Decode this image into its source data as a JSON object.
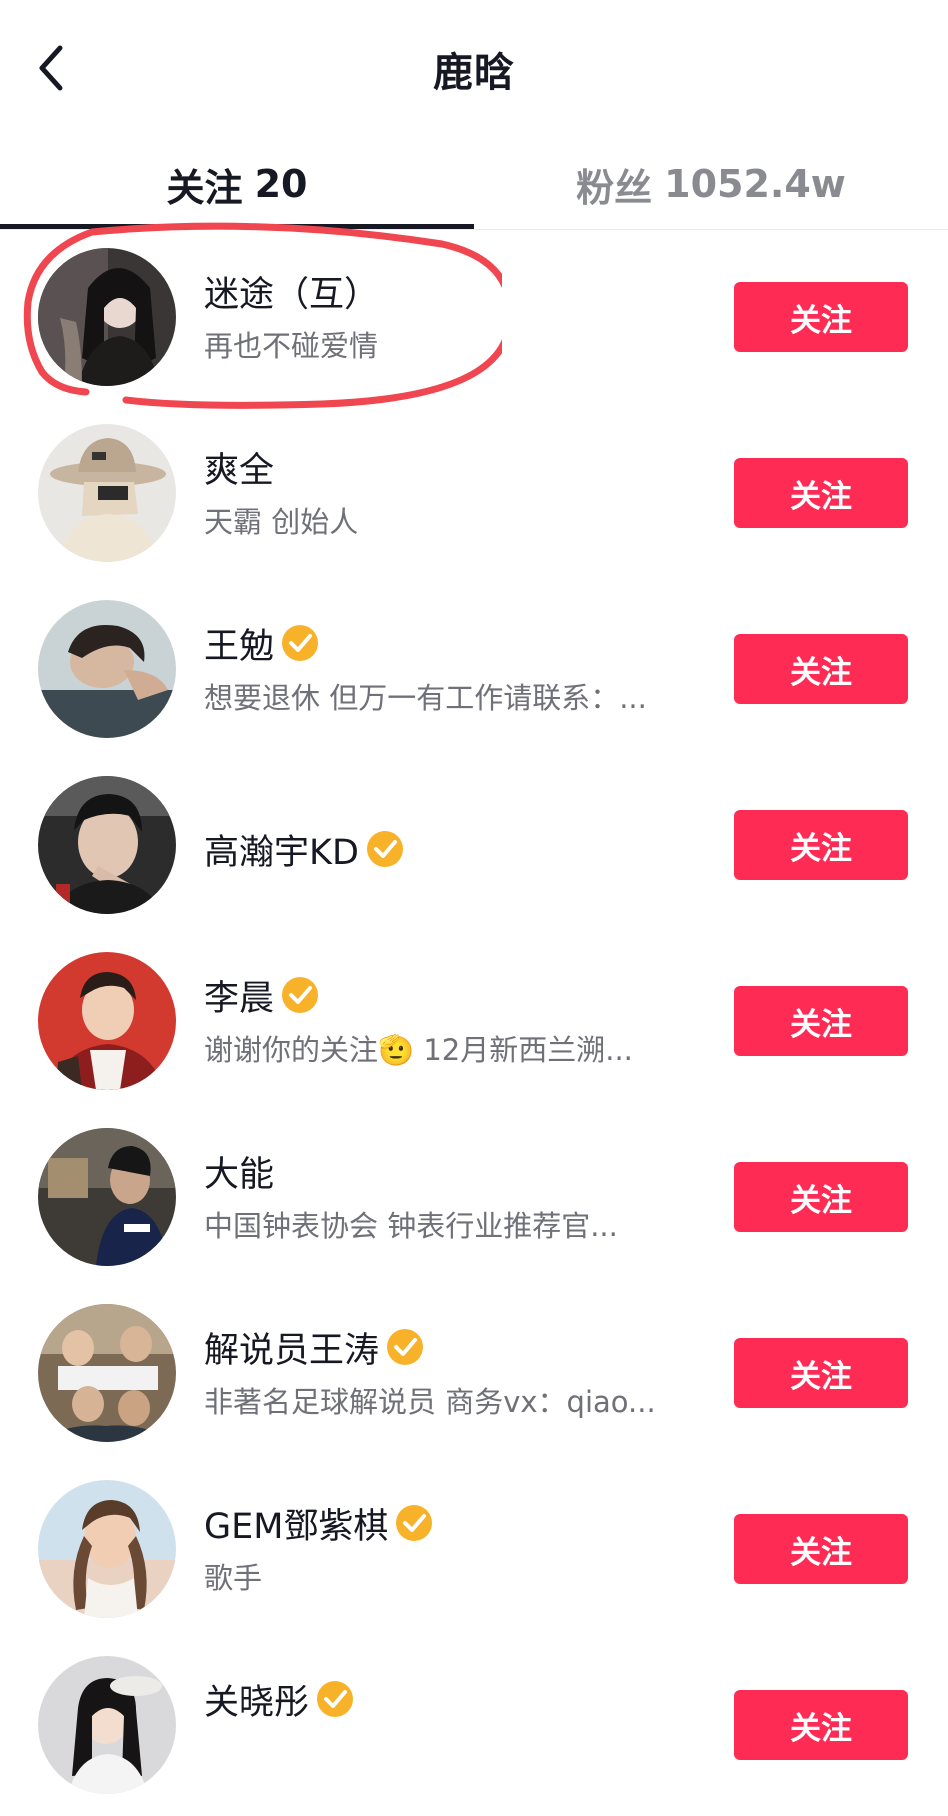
{
  "header": {
    "title": "鹿晗"
  },
  "tabs": [
    {
      "label": "关注",
      "count": "20",
      "active": true
    },
    {
      "label": "粉丝",
      "count": "1052.4w",
      "active": false
    }
  ],
  "colors": {
    "follow_button": "#fe2c55",
    "verified": "#f7b22a",
    "highlight": "#f0464f"
  },
  "users": [
    {
      "name": "迷途（互）",
      "bio": "再也不碰爱情",
      "verified": false,
      "button": "关注"
    },
    {
      "name": "爽全",
      "bio": "天霸 创始人",
      "verified": false,
      "button": "关注"
    },
    {
      "name": "王勉",
      "bio": "想要退休 但万一有工作请联系：...",
      "verified": true,
      "button": "关注"
    },
    {
      "name": "高瀚宇KD",
      "bio": "",
      "verified": true,
      "button": "关注"
    },
    {
      "name": "李晨",
      "bio": "谢谢你的关注🫡 12月新西兰溯...",
      "verified": true,
      "button": "关注"
    },
    {
      "name": "大能",
      "bio": "中国钟表协会 钟表行业推荐官...",
      "verified": false,
      "button": "关注"
    },
    {
      "name": "解说员王涛",
      "bio": "非著名足球解说员 商务vx：qiao...",
      "verified": true,
      "button": "关注"
    },
    {
      "name": "GEM鄧紫棋",
      "bio": "歌手",
      "verified": true,
      "button": "关注"
    },
    {
      "name": "关晓彤",
      "bio": "",
      "verified": true,
      "button": "关注"
    }
  ]
}
